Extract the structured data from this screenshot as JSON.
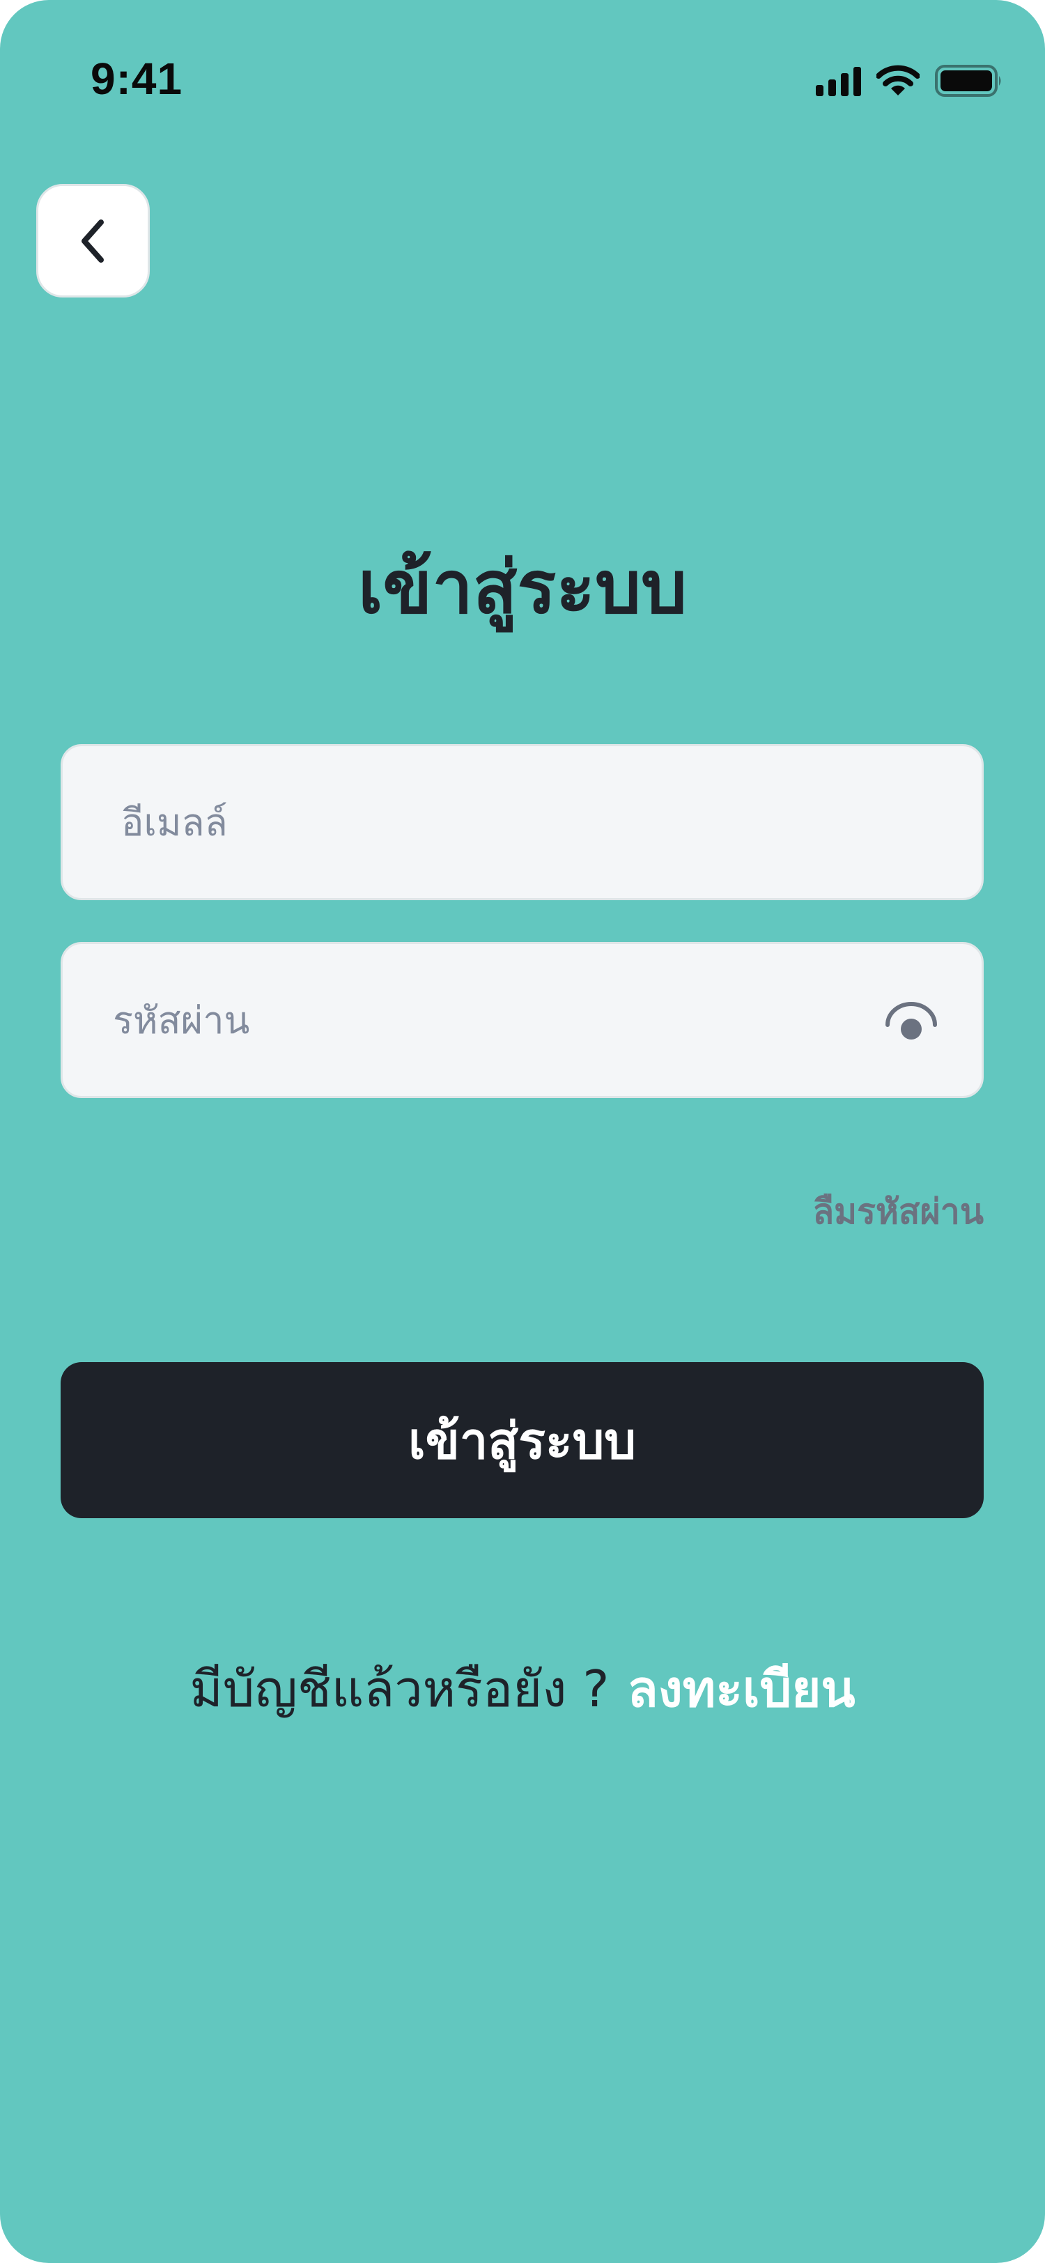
{
  "status_bar": {
    "time": "9:41",
    "icons": [
      "cellular-signal-icon",
      "wifi-icon",
      "battery-icon"
    ]
  },
  "header": {
    "back_icon": "chevron-left-icon"
  },
  "title": "เข้าสู่ระบบ",
  "form": {
    "email": {
      "value": "",
      "placeholder": "อีเมลล์"
    },
    "password": {
      "value": "",
      "placeholder": "รหัสผ่าน",
      "toggle_icon": "eye-icon"
    }
  },
  "forgot_password_label": "ลืมรหัสผ่าน",
  "login_button_label": "เข้าสู่ระบบ",
  "register": {
    "question": "มีบัญชีแล้วหรือยัง ?",
    "link_label": "ลงทะเบียน"
  },
  "colors": {
    "background": "#62c7bf",
    "primary_dark": "#1e2229",
    "input_bg": "#f4f6f8",
    "muted_text": "#6b7280",
    "link": "#ffffff"
  }
}
